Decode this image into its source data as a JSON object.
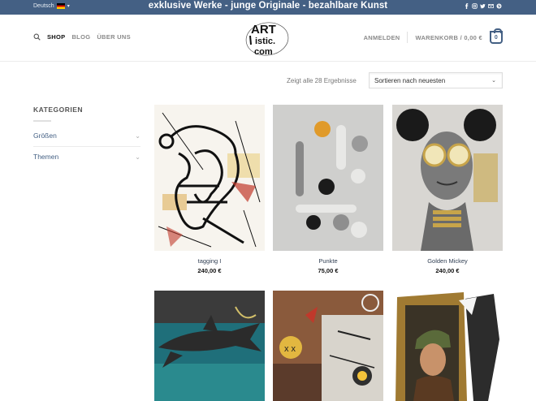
{
  "topbar": {
    "language": "Deutsch",
    "tagline": "exklusive Werke - junge Originale - bezahlbare Kunst",
    "social_icons": [
      "facebook-icon",
      "instagram-icon",
      "twitter-icon",
      "email-icon",
      "pinterest-icon"
    ]
  },
  "nav": {
    "shop": "SHOP",
    "blog": "BLOG",
    "about": "ÜBER UNS",
    "login": "ANMELDEN",
    "cart": "WARENKORB / 0,00 €",
    "cart_count": "0"
  },
  "logo": {
    "text_top": "ART",
    "text_mid": "istic.",
    "text_bottom": "com"
  },
  "shop": {
    "results": "Zeigt alle 28 Ergebnisse",
    "sort": "Sortieren nach neuesten"
  },
  "sidebar": {
    "title": "KATEGORIEN",
    "categories": [
      "Größen",
      "Themen"
    ]
  },
  "products": [
    {
      "name": "tagging I",
      "price": "240,00 €"
    },
    {
      "name": "Punkte",
      "price": "75,00 €"
    },
    {
      "name": "Golden Mickey",
      "price": "240,00 €"
    }
  ],
  "colors": {
    "topbar": "#446084",
    "accent": "#446084"
  }
}
